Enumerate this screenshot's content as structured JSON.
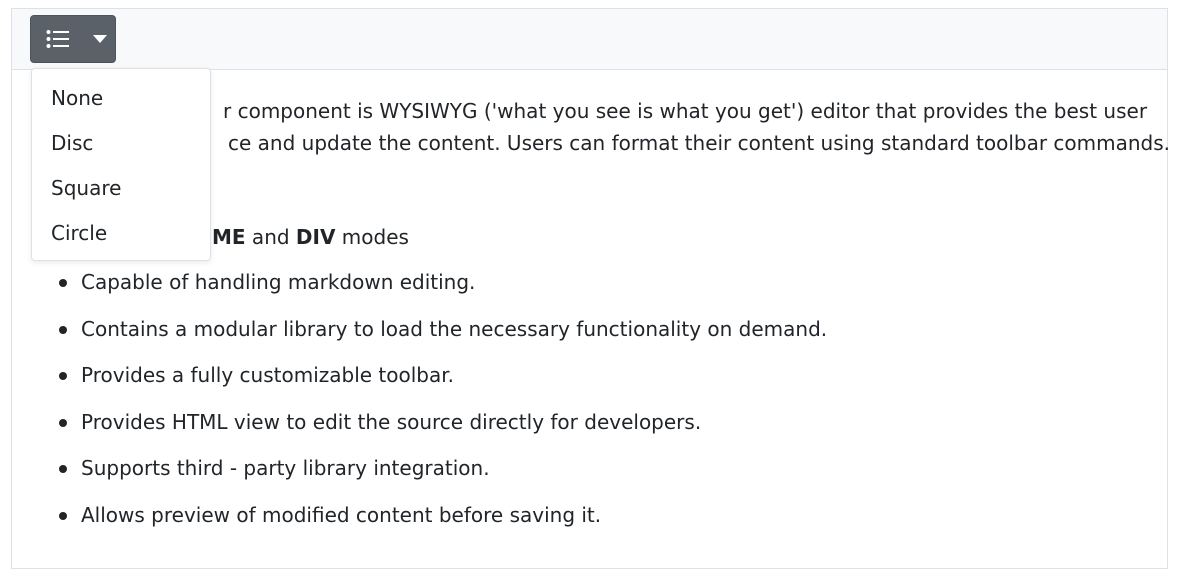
{
  "toolbar": {
    "list_button_icon": "bulleted-list-icon",
    "dropdown_icon": "caret-down-icon"
  },
  "dropdown": {
    "items": [
      "None",
      "Disc",
      "Square",
      "Circle"
    ]
  },
  "content": {
    "para_line1": "r component is WYSIWYG ('what you see is what you get') editor that provides the best user",
    "para_line2": "ce and update the content. Users can format their content using standard toolbar commands.",
    "modes_bold1": "ME",
    "modes_and": " and ",
    "modes_bold2": "DIV",
    "modes_suffix": " modes",
    "bullets": [
      "Capable of handling markdown editing.",
      "Contains a modular library to load the necessary functionality on demand.",
      "Provides a fully customizable toolbar.",
      "Provides HTML view to edit the source directly for developers.",
      "Supports third - party library integration.",
      "Allows preview of modified content before saving it."
    ]
  }
}
